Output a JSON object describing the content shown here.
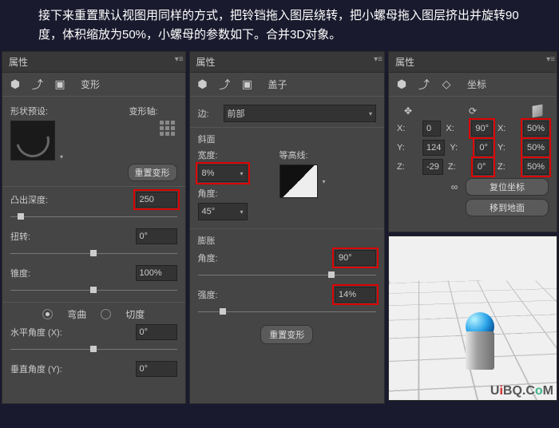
{
  "instruction": "接下来重置默认视图用同样的方式，把铃铛拖入图层绕转，把小螺母拖入图层挤出并旋转90度，体积缩放为50%，小螺母的参数如下。合并3D对象。",
  "panels": {
    "deform": {
      "title": "属性",
      "tab": "变形",
      "shape_preset": "形状预设:",
      "axis_label": "变形轴:",
      "reset_btn": "重置变形",
      "extrude_depth_label": "凸出深度:",
      "extrude_depth": "250",
      "twist_label": "扭转:",
      "twist": "0°",
      "taper_label": "锥度:",
      "taper": "100%",
      "bend_label": "弯曲",
      "shear_label": "切度",
      "horiz_label": "水平角度 (X):",
      "horiz": "0°",
      "vert_label": "垂直角度 (Y):",
      "vert": "0°"
    },
    "cap": {
      "title": "属性",
      "tab": "盖子",
      "side_label": "边:",
      "side_value": "前部",
      "bevel_header": "斜面",
      "width_label": "宽度:",
      "width": "8%",
      "contour_label": "等高线:",
      "angle_label": "角度:",
      "angle": "45°",
      "inflate_header": "膨胀",
      "inflate_angle_label": "角度:",
      "inflate_angle": "90°",
      "strength_label": "强度:",
      "strength": "14%",
      "reset_btn": "重置变形"
    },
    "coords": {
      "title": "属性",
      "tab": "坐标",
      "pos": {
        "x": "0",
        "y": "124",
        "z": "-29"
      },
      "rot": {
        "x": "90°",
        "y": "0°",
        "z": "0°"
      },
      "scale": {
        "x": "50%",
        "y": "50%",
        "z": "50%"
      },
      "reset_btn": "复位坐标",
      "ground_btn": "移到地面"
    }
  },
  "watermark": "UiBQ.CoM"
}
